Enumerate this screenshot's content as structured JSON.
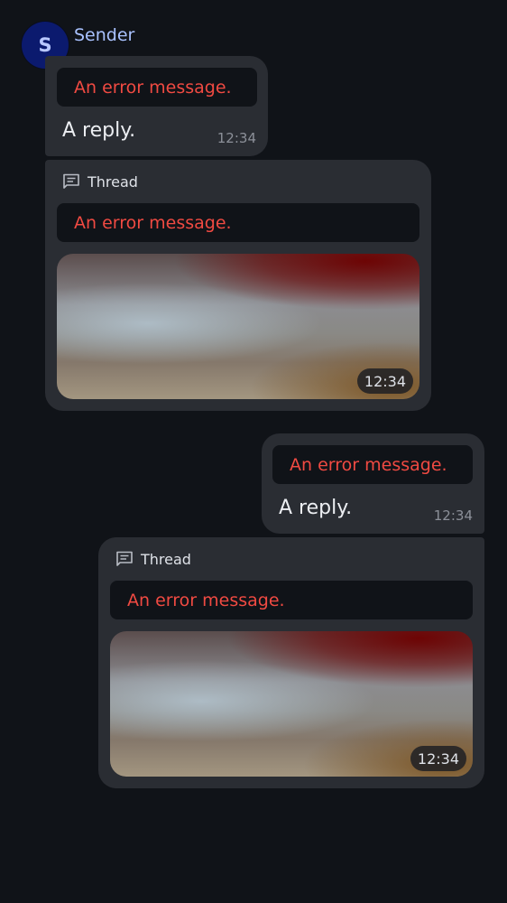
{
  "sender": {
    "avatar_initial": "S",
    "name": "Sender"
  },
  "incoming": {
    "reply_message": {
      "quote_text": "An error message.",
      "body": "A reply.",
      "timestamp": "12:34"
    },
    "thread_message": {
      "thread_label": "Thread",
      "quote_text": "An error message.",
      "timestamp": "12:34"
    }
  },
  "outgoing": {
    "reply_message": {
      "quote_text": "An error message.",
      "body": "A reply.",
      "timestamp": "12:34"
    },
    "thread_message": {
      "thread_label": "Thread",
      "quote_text": "An error message.",
      "timestamp": "12:34"
    }
  },
  "colors": {
    "background": "#101318",
    "bubble": "#2a2d33",
    "error_text": "#f04a42",
    "sender_name": "#a9c2ff",
    "avatar": "#0b1a6e"
  },
  "icons": {
    "thread": "thread-icon"
  }
}
